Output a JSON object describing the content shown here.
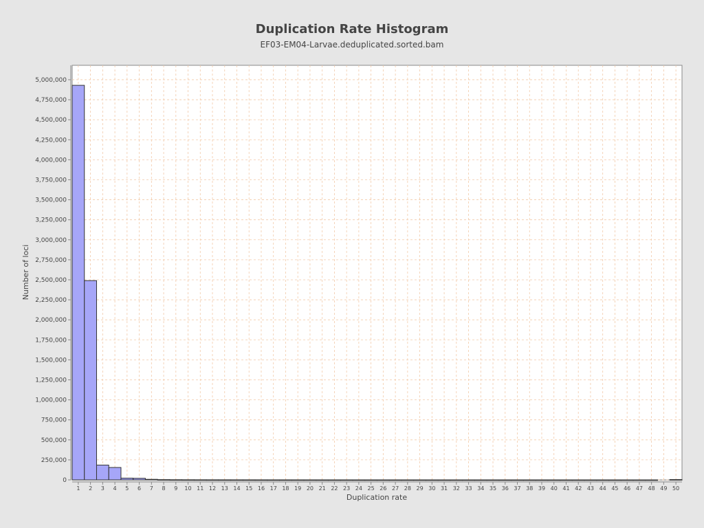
{
  "chart_data": {
    "type": "bar",
    "title": "Duplication Rate Histogram",
    "subtitle": "EF03-EM04-Larvae.deduplicated.sorted.bam",
    "xlabel": "Duplication rate",
    "ylabel": "Number of loci",
    "categories": [
      "1",
      "2",
      "3",
      "4",
      "5",
      "6",
      "7",
      "8",
      "9",
      "10",
      "11",
      "12",
      "13",
      "14",
      "15",
      "16",
      "17",
      "18",
      "19",
      "20",
      "21",
      "22",
      "23",
      "24",
      "25",
      "26",
      "27",
      "28",
      "29",
      "30",
      "31",
      "32",
      "33",
      "34",
      "35",
      "36",
      "37",
      "38",
      "39",
      "40",
      "41",
      "42",
      "43",
      "44",
      "45",
      "46",
      "47",
      "48",
      "49",
      "50"
    ],
    "values": [
      4930000,
      2490000,
      185000,
      155000,
      22000,
      20000,
      7000,
      3000,
      2000,
      1500,
      1200,
      1000,
      900,
      800,
      700,
      600,
      500,
      450,
      400,
      350,
      300,
      280,
      260,
      240,
      220,
      200,
      190,
      180,
      170,
      160,
      150,
      140,
      130,
      120,
      110,
      100,
      95,
      90,
      85,
      80,
      75,
      70,
      65,
      60,
      55,
      50,
      45,
      40,
      0,
      4000
    ],
    "yticks": [
      0,
      250000,
      500000,
      750000,
      1000000,
      1250000,
      1500000,
      1750000,
      2000000,
      2250000,
      2500000,
      2750000,
      3000000,
      3250000,
      3500000,
      3750000,
      4000000,
      4250000,
      4500000,
      4750000,
      5000000
    ],
    "ytick_labels": [
      "0",
      "250,000",
      "500,000",
      "750,000",
      "1,000,000",
      "1,250,000",
      "1,500,000",
      "1,750,000",
      "2,000,000",
      "2,250,000",
      "2,500,000",
      "2,750,000",
      "3,000,000",
      "3,250,000",
      "3,500,000",
      "3,750,000",
      "4,000,000",
      "4,250,000",
      "4,500,000",
      "4,750,000",
      "5,000,000"
    ],
    "ylim": [
      0,
      5180000
    ],
    "xlim": [
      0.5,
      50.5
    ],
    "grid": true,
    "colors": {
      "bar_fill": "#a6a6f8",
      "bar_stroke": "#333333",
      "grid": "#f2c9a8",
      "plot_bg": "#ffffff",
      "page_bg": "#e6e6e6",
      "axis": "#888888"
    }
  }
}
